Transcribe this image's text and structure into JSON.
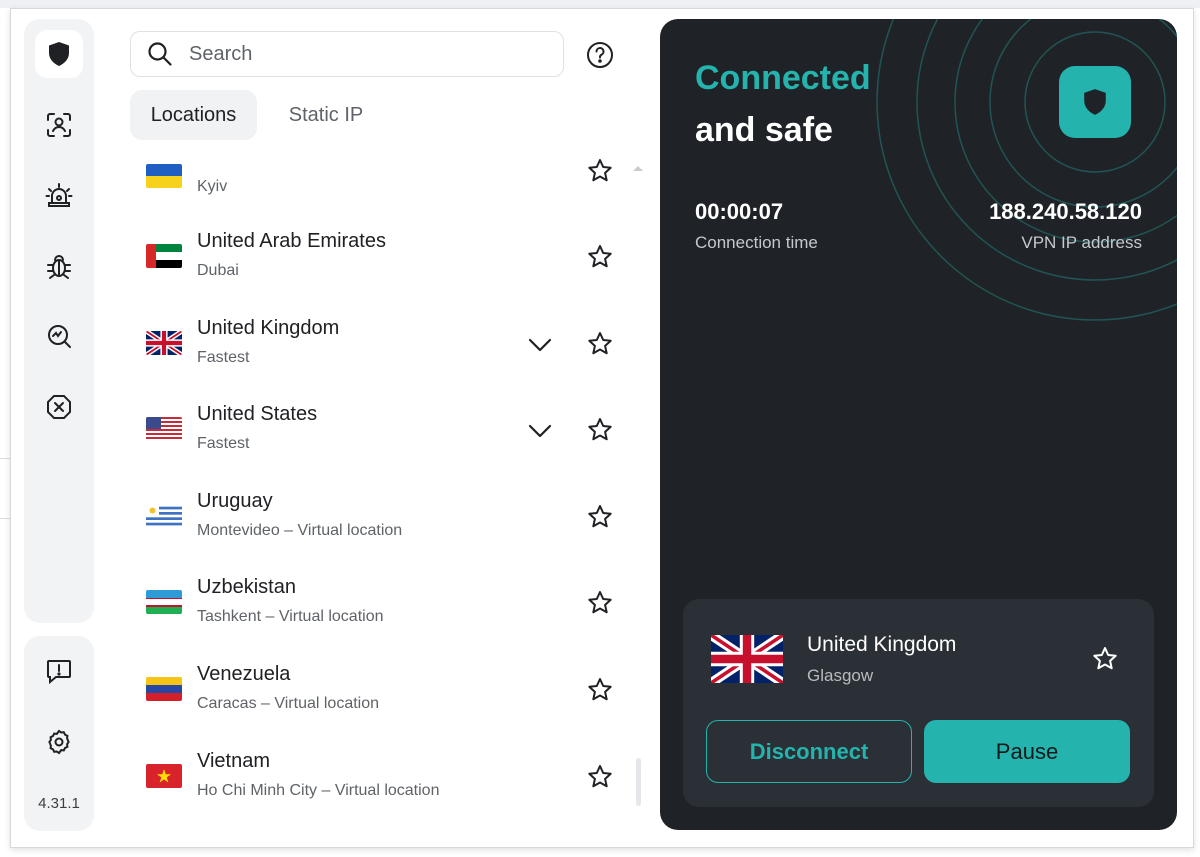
{
  "search": {
    "placeholder": "Search"
  },
  "tabs": [
    {
      "label": "Locations",
      "active": true
    },
    {
      "label": "Static IP",
      "active": false
    }
  ],
  "sidebar": {
    "icons": [
      "shield-icon",
      "face-scan-icon",
      "alarm-icon",
      "bug-icon",
      "monitor-check-icon",
      "block-icon"
    ],
    "bottom_icons": [
      "feedback-icon",
      "settings-icon"
    ],
    "version": "4.31.1"
  },
  "locations": [
    {
      "country": "",
      "city": "Kyiv",
      "flag": "ua",
      "expandable": false
    },
    {
      "country": "United Arab Emirates",
      "city": "Dubai",
      "flag": "ae",
      "expandable": false
    },
    {
      "country": "United Kingdom",
      "city": "Fastest",
      "flag": "gb",
      "expandable": true
    },
    {
      "country": "United States",
      "city": "Fastest",
      "flag": "us",
      "expandable": true
    },
    {
      "country": "Uruguay",
      "city": "Montevideo – Virtual location",
      "flag": "uy",
      "expandable": false
    },
    {
      "country": "Uzbekistan",
      "city": "Tashkent – Virtual location",
      "flag": "uz",
      "expandable": false
    },
    {
      "country": "Venezuela",
      "city": "Caracas – Virtual location",
      "flag": "ve",
      "expandable": false
    },
    {
      "country": "Vietnam",
      "city": "Ho Chi Minh City – Virtual location",
      "flag": "vn",
      "expandable": false
    }
  ],
  "status": {
    "line1": "Connected",
    "line2": "and safe",
    "connection_time": "00:00:07",
    "connection_time_label": "Connection time",
    "ip": "188.240.58.120",
    "ip_label": "VPN IP address"
  },
  "current": {
    "country": "United Kingdom",
    "city": "Glasgow",
    "flag": "gb",
    "disconnect_label": "Disconnect",
    "pause_label": "Pause"
  },
  "colors": {
    "accent": "#24b3ad",
    "panel": "#1f2327",
    "card": "#2b3036"
  }
}
